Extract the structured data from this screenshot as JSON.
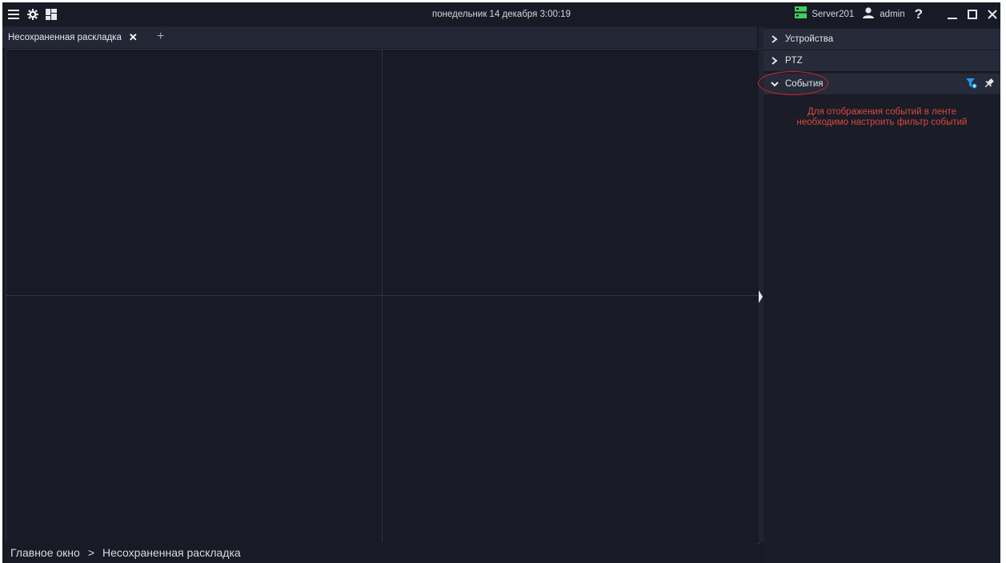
{
  "titlebar": {
    "icons": [
      "menu-icon",
      "gear-icon",
      "layout-grid-icon"
    ],
    "clock": "понедельник 14 декабря 3:00:19",
    "server_name": "Server201",
    "user_name": "admin",
    "help_label": "?",
    "window_controls": [
      "minimize-icon",
      "maximize-icon",
      "close-icon"
    ]
  },
  "tabs": [
    {
      "label": "Несохраненная раскладка",
      "close_label": "✕"
    }
  ],
  "add_tab_label": "+",
  "layout": {
    "cells": [
      "cell-1",
      "cell-2",
      "cell-3",
      "cell-4"
    ]
  },
  "panel": {
    "sections": [
      {
        "label": "Устройства",
        "state": "collapsed"
      },
      {
        "label": "PTZ",
        "state": "collapsed"
      },
      {
        "label": "События",
        "state": "expanded",
        "tools": [
          "filter-icon",
          "pin-icon"
        ]
      }
    ],
    "events_message": {
      "line1": "Для отображения событий в ленте",
      "line2": "необходимо настроить фильтр событий"
    }
  },
  "statusbar": {
    "crumbs": [
      "Главное окно",
      "Несохраненная раскладка"
    ],
    "separator": ">"
  },
  "colors": {
    "background": "#181a25",
    "panel_header": "#272a38",
    "server_status": "#3fcf5a",
    "filter_accent": "#1e9be8",
    "message": "#d94a3c",
    "highlight": "#d2242b"
  }
}
